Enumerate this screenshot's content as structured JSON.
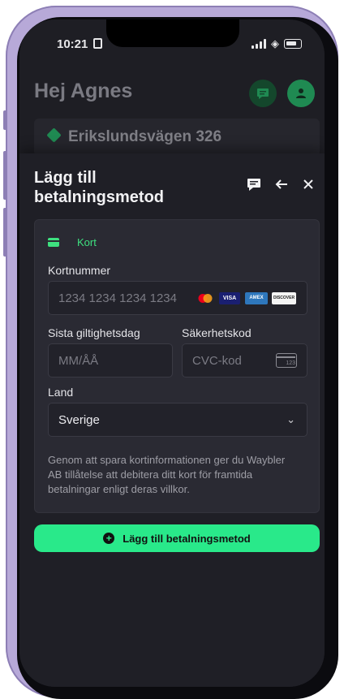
{
  "status_bar": {
    "time": "10:21"
  },
  "header": {
    "greeting": "Hej Agnes",
    "address": "Erikslundsvägen 326"
  },
  "sheet": {
    "title": "Lägg till betalningsmetod",
    "method_tab": "Kort",
    "card_number": {
      "label": "Kortnummer",
      "placeholder": "1234 1234 1234 1234"
    },
    "card_brands": [
      "VISA",
      "AMEX",
      "DISCOVER"
    ],
    "expiry": {
      "label": "Sista giltighetsdag",
      "placeholder": "MM/ÅÅ"
    },
    "cvc": {
      "label": "Säkerhetskod",
      "placeholder": "CVC-kod",
      "icon_text": "123"
    },
    "country": {
      "label": "Land",
      "value": "Sverige"
    },
    "notice": "Genom att spara kortinformationen ger du Waybler AB tillåtelse att debitera ditt kort för framtida betalningar enligt deras villkor.",
    "submit_label": "Lägg till betalningsmetod"
  },
  "colors": {
    "accent": "#29e98a",
    "accent_dark": "#1f8a52",
    "sheet_bg": "#1f1f26",
    "card_bg": "#2a2a33"
  }
}
